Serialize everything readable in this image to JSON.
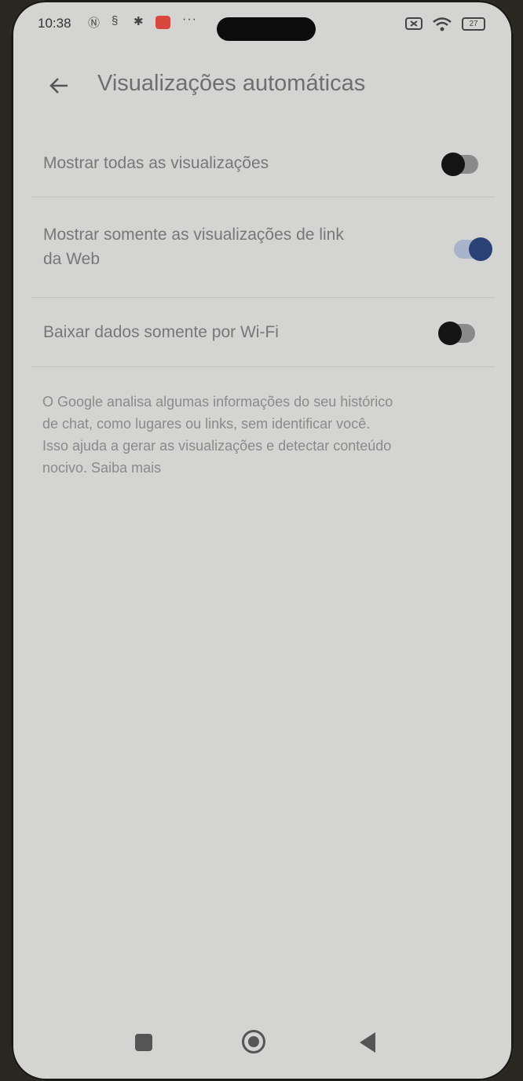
{
  "status_bar": {
    "time": "10:38",
    "icons": [
      "nfc-icon",
      "sync-icon",
      "gear-icon",
      "mail-icon"
    ],
    "more": "···",
    "battery": "27"
  },
  "header": {
    "title": "Visualizações automáticas"
  },
  "settings": [
    {
      "label": "Mostrar todas as visualizações",
      "enabled": false
    },
    {
      "label_line1": "Mostrar somente as visualizações de link",
      "label_line2": "da Web",
      "enabled": true
    },
    {
      "label": "Baixar dados somente por Wi-Fi",
      "enabled": false
    }
  ],
  "info_text": {
    "line1": "O Google analisa algumas informações do seu histórico",
    "line2": "de chat, como lugares ou links, sem identificar você.",
    "line3": "Isso ajuda a gerar as visualizações e detectar conteúdo",
    "line4_prefix": "nocivo. ",
    "learn_more": "Saiba mais"
  },
  "colors": {
    "background": "#d4d4d2",
    "toggle_on": "#2a4176",
    "toggle_off": "#141414"
  }
}
